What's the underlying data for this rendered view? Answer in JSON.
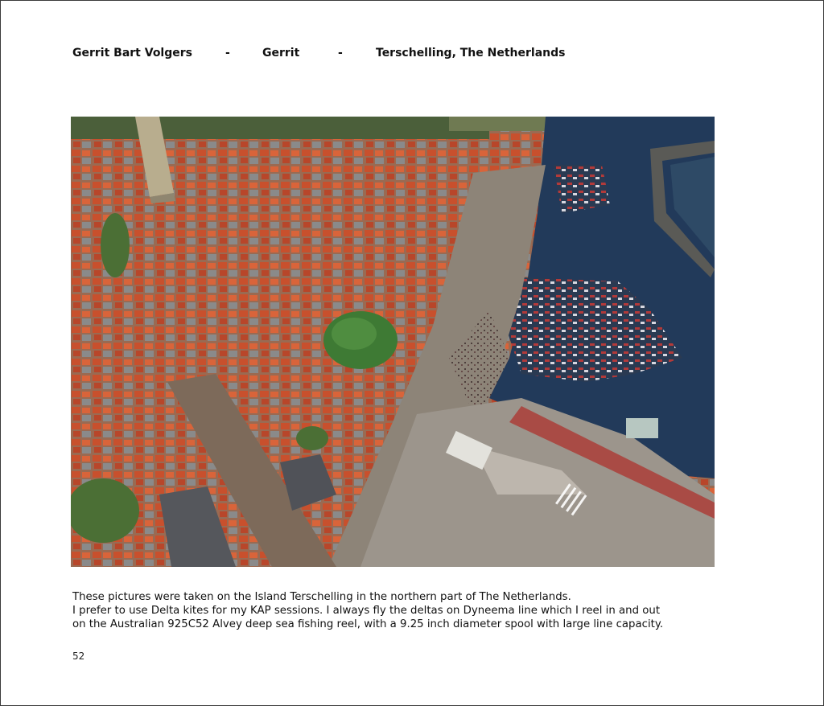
{
  "header": {
    "photographer": "Gerrit Bart Volgers",
    "separator_1": "-",
    "nickname": "Gerrit",
    "separator_2": "-",
    "location": "Terschelling, The Netherlands"
  },
  "photo": {
    "subject": "Aerial kite photograph of a harbour town with red-roofed houses, a tower, a busy street and a marina full of boats",
    "colors": {
      "water": "#223a5a",
      "roof": "#c8502d",
      "street": "#8d8478",
      "tree": "#3e7a34"
    }
  },
  "caption": {
    "line_1": "These pictures were taken on the Island Terschelling in the northern part of The Netherlands.",
    "line_2": "I prefer to use Delta kites for my KAP sessions. I always fly the deltas on Dyneema line which I reel in and out",
    "line_3": "on the Australian  925C52 Alvey deep sea fishing reel, with a 9.25 inch diameter spool with large line capacity."
  },
  "page_number": "52"
}
